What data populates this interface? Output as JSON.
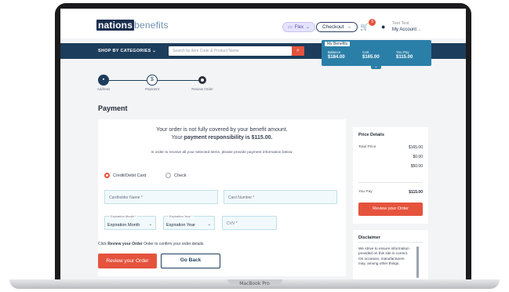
{
  "header": {
    "logo_dark": "nations",
    "logo_light": "benefits",
    "flex_label": "Flex",
    "checkout_label": "Checkout",
    "cart_count": "3",
    "user_name": "Test Test",
    "account_label": "My Account"
  },
  "nav": {
    "shop_label": "SHOP BY CATEGORIES",
    "search_placeholder": "Search by item Code & Product Name"
  },
  "benefits": {
    "title": "My Benefits",
    "balance_label": "Balance",
    "balance_value": "$184.00",
    "cart_label": "Cart",
    "cart_value": "$165.00",
    "you_pay_label": "You Pay",
    "you_pay_value": "$115.00"
  },
  "steps": {
    "address": "Address",
    "payment": "Payment",
    "payment_symbol": "$",
    "review": "Review Order"
  },
  "payment": {
    "title": "Payment",
    "message_line1": "Your order is not fully covered by your benefit amount.",
    "message_line2_prefix": "Your ",
    "message_line2_bold": "payment responsibility is $115.00.",
    "info": "In order to receive all your selected items, please provide payment information below.",
    "option_card": "Credit/Debit Card",
    "option_check": "Check",
    "cardholder_placeholder": "Cardholder Name *",
    "card_number_placeholder": "Card Number *",
    "exp_month_label": "Expiration Month *",
    "exp_month_value": "Expiration Month",
    "exp_year_label": "Expiration Year *",
    "exp_year_value": "Expiration Year",
    "cvv_placeholder": "CVV *",
    "click_prefix": "Click ",
    "click_bold": "Review your Order",
    "click_suffix": " Order to confirm your order details.",
    "review_button": "Review your Order",
    "back_button": "Go Back"
  },
  "price_details": {
    "title": "Price Details",
    "total_price_label": "Total Price",
    "values": [
      "$165.00",
      "$0.00",
      "$50.00"
    ],
    "you_pay_label": "You Pay",
    "you_pay_value": "$115.00",
    "review_button": "Review your Order"
  },
  "disclaimer": {
    "title": "Disclaimer",
    "text": "We strive to ensure information provided on this site is correct. On occasion, manufacturers may, among other things,"
  },
  "device_label": "MacBook Pro",
  "colors": {
    "accent": "#e5533d",
    "navy": "#1d3d5c",
    "teal": "#2a7fa8"
  }
}
